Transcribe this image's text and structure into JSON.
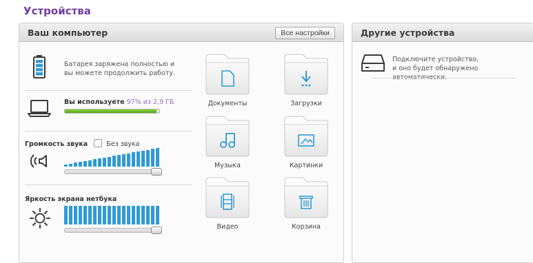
{
  "page": {
    "title": "Устройства"
  },
  "left_panel": {
    "title": "Ваш компьютер",
    "all_settings_label": "Все настройки",
    "battery": {
      "text_line1": "Батарея заряжена полностью и",
      "text_line2": "вы можете продолжить работу."
    },
    "storage": {
      "label": "Вы используете",
      "usage": "97% из 2,9 ГБ",
      "used_fraction": 0.97
    },
    "volume": {
      "label": "Громкость звука",
      "mute_label": "Без звука",
      "mute_checked": false,
      "level": 1.0
    },
    "brightness": {
      "label": "Яркость экрана нетбука",
      "level": 1.0
    },
    "folders": [
      {
        "label": "Документы",
        "icon": "document-icon"
      },
      {
        "label": "Загрузки",
        "icon": "download-icon"
      },
      {
        "label": "Музыка",
        "icon": "music-icon"
      },
      {
        "label": "Картинки",
        "icon": "picture-icon"
      },
      {
        "label": "Видео",
        "icon": "film-icon"
      },
      {
        "label": "Корзина",
        "icon": "trash-icon"
      }
    ]
  },
  "right_panel": {
    "title": "Другие устройства",
    "hint_line1": "Подключите устройство,",
    "hint_line2": "и оно будет обнаружено автоматически."
  },
  "colors": {
    "accent_purple": "#6f3fa0",
    "icon_blue": "#2f9bd4",
    "storage_green": "#55a61c"
  }
}
